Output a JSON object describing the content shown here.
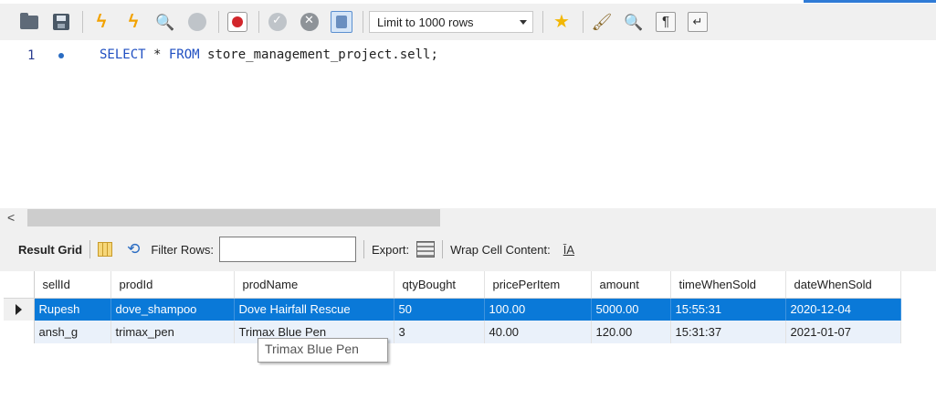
{
  "toolbar": {
    "limit_select": {
      "selected": "Limit to 1000 rows"
    },
    "icons": [
      "folder-icon",
      "save-icon",
      "execute-icon",
      "execute-current-icon",
      "explain-icon",
      "stop-icon",
      "stop-on-error-icon",
      "commit-icon",
      "rollback-icon",
      "toggle-autocommit-icon",
      "bookmark-star-icon",
      "beautify-icon",
      "find-icon",
      "invisible-chars-icon",
      "wrap-lines-icon"
    ]
  },
  "editor": {
    "line_number": "1",
    "code": {
      "kw1": "SELECT",
      "part1": " * ",
      "kw2": "FROM",
      "part2": " store_management_project.sell;"
    }
  },
  "result_toolbar": {
    "result_grid_label": "Result Grid",
    "filter_rows_label": "Filter Rows:",
    "filter_value": "",
    "export_label": "Export:",
    "wrap_cell_label": "Wrap Cell Content:",
    "wrap_icon_text": "ĪA"
  },
  "grid": {
    "columns": [
      "sellId",
      "prodId",
      "prodName",
      "qtyBought",
      "pricePerItem",
      "amount",
      "timeWhenSold",
      "dateWhenSold"
    ],
    "rows": [
      [
        "Rupesh",
        "dove_shampoo",
        "Dove Hairfall Rescue",
        "50",
        "100.00",
        "5000.00",
        "15:55:31",
        "2020-12-04"
      ],
      [
        "ansh_g",
        "trimax_pen",
        "Trimax Blue Pen",
        "3",
        "40.00",
        "120.00",
        "15:31:37",
        "2021-01-07"
      ]
    ]
  },
  "tooltip": {
    "text": "Trimax Blue Pen"
  },
  "colors": {
    "selection": "#0a79d8",
    "keyword": "#1f4fc2",
    "alt_row": "#eaf1fa"
  }
}
